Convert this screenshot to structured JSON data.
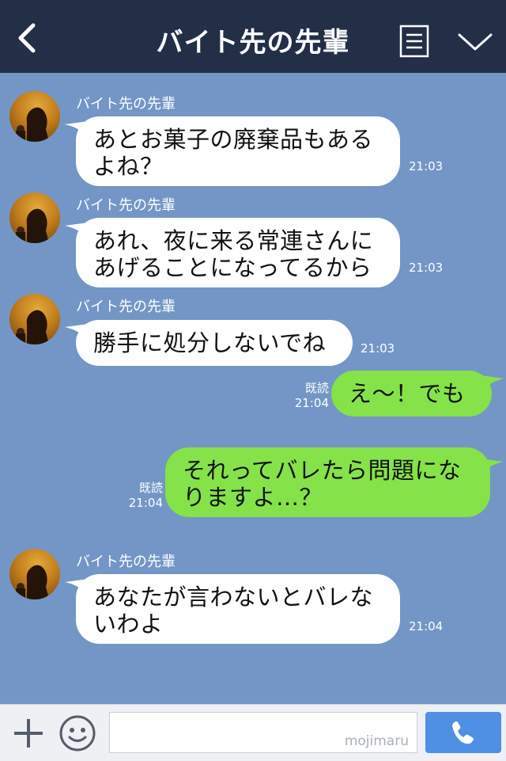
{
  "header": {
    "title": "バイト先の先輩"
  },
  "messages": [
    {
      "sender": "バイト先の先輩",
      "line1": "あとお菓子の廃棄品もある",
      "line2": "よね？",
      "time": "21:03"
    },
    {
      "sender": "バイト先の先輩",
      "line1": "あれ、夜に来る常連さんに",
      "line2": "あげることになってるから",
      "time": "21:03"
    },
    {
      "sender": "バイト先の先輩",
      "line1": "勝手に処分しないでね",
      "time": "21:03"
    },
    {
      "read": "既読",
      "line1": "え〜！でも",
      "time": "21:04"
    },
    {
      "read": "既読",
      "line1": "それってバレたら問題にな",
      "line2": "りますよ…？",
      "time": "21:04"
    },
    {
      "sender": "バイト先の先輩",
      "line1": "あなたが言わないとバレな",
      "line2": "いわよ",
      "time": "21:04"
    }
  ],
  "footer": {
    "watermark": "mojimaru"
  }
}
